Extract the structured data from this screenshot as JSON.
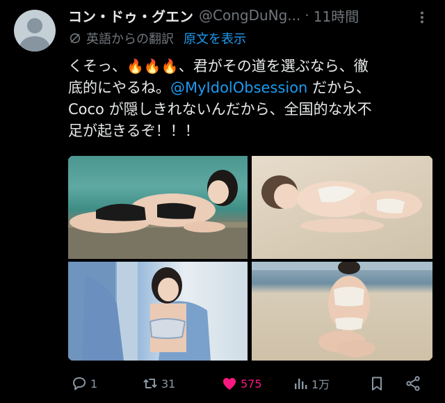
{
  "author": {
    "display_name": "コン・ドゥ・グエン",
    "handle": "@CongDuNg...",
    "separator": "·",
    "time": "11時間"
  },
  "translation": {
    "label": "英語からの翻訳",
    "show_original": "原文を表示"
  },
  "tweet": {
    "line1_prefix": "くそっ、",
    "line1_emojis": "🔥🔥🔥",
    "line1_suffix": "、君がその道を選ぶなら、徹",
    "line2_prefix": "底的にやるね。",
    "mention": "@MyIdolObsession",
    "line2_suffix": " だから、",
    "line3": "Coco が隠しきれないんだから、全国的な水不",
    "line4": "足が起きるぞ！！！"
  },
  "media": {
    "count": 4
  },
  "actions": {
    "replies": "1",
    "reposts": "31",
    "likes": "575",
    "views": "1万"
  },
  "colors": {
    "background": "#000000",
    "text": "#e7e9ea",
    "secondary": "#71767b",
    "link": "#1d9bf0",
    "like": "#f91880"
  }
}
